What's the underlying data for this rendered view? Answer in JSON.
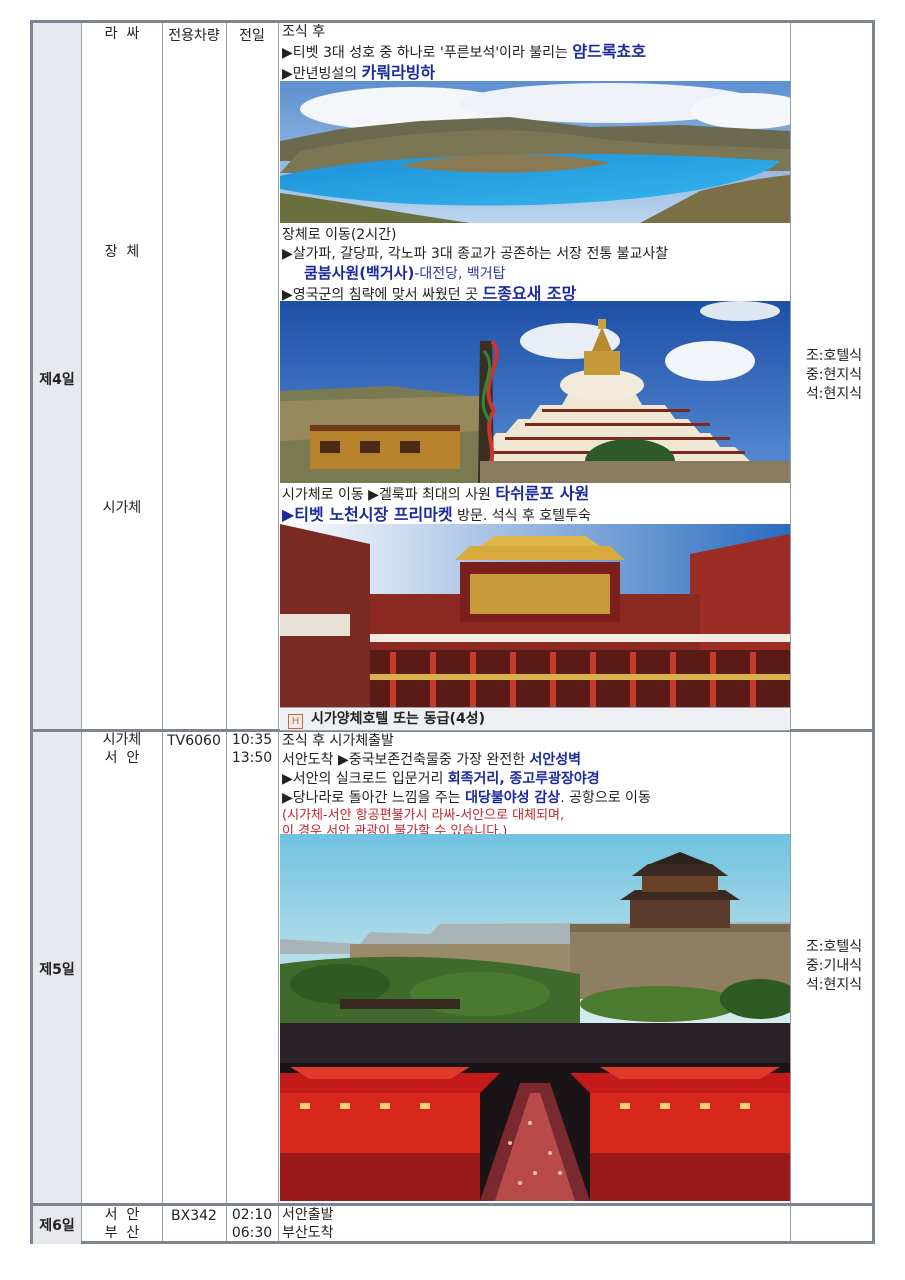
{
  "header": {
    "vehicle": "전용차량",
    "day_trip": "전일"
  },
  "day4": {
    "label": "제4일",
    "places": [
      "라  싸",
      "장  체",
      "시가체"
    ],
    "lines": {
      "breakfast": "조식 후",
      "l1_prefix": "▶티벳 3대 성호 중 하나로 '푸른보석'이라 불리는 ",
      "l1_highlight": "얌드록쵸호",
      "l2_prefix": "▶만년빙설의 ",
      "l2_highlight": "카뤄라빙하",
      "l3": "장체로 이동(2시간)",
      "l4": "▶살가파, 갈당파, 각노파 3대 종교가 공존하는 서장 전통 불교사찰",
      "l5_highlight": "쿰붐사원(백거사)",
      "l5_suffix": "-대전당, 백거탑",
      "l6_prefix": "▶영국군의 침략에 맞서 싸웠던 곳 ",
      "l6_highlight": "드종요새 조망",
      "l7_prefix": "시가체로 이동 ▶겔룩파 최대의 사원 ",
      "l7_highlight": "타쉬룬포 사원",
      "l8_highlight": "▶티벳 노천시장 프리마켓",
      "l8_suffix": " 방문. 석식 후 호텔투숙"
    },
    "hotel_icon": "H",
    "hotel": "시가양체호텔 또는 동급(4성)",
    "meals": [
      "조:호텔식",
      "중:현지식",
      "석:현지식"
    ]
  },
  "day5": {
    "label": "제5일",
    "places": "시가체\n서  안",
    "flight": "TV6060",
    "times": "10:35\n13:50",
    "lines": {
      "l1": "조식 후 시가체출발",
      "l2_prefix": "서안도착 ▶중국보존건축물중 가장 완전한 ",
      "l2_highlight": "서안성벽",
      "l3_prefix": "▶서안의 실크로드 입문거리 ",
      "l3_highlight": "회족거리, 종고루광장야경",
      "l4_prefix": "▶당나라로 돌아간 느낌을 주는 ",
      "l4_highlight": "대당불야성 감상",
      "l4_suffix": ". 공항으로 이동",
      "note1": "(시가체-서안 항공편불가시 라싸-서안으로 대체되며,",
      "note2": " 이 경우 서안 관광이 불가할 수 있습니다.)"
    },
    "meals": [
      "조:호텔식",
      "중:기내식",
      "석:현지식"
    ]
  },
  "day6": {
    "label": "제6일",
    "places": "서  안\n부  산",
    "flight": "BX342",
    "times": "02:10\n06:30",
    "lines": {
      "l1": "서안출발",
      "l2": "부산도착"
    }
  },
  "colors": {
    "highlight_blue": "#1a2a9e",
    "note_red": "#c1272d",
    "day_bg": "#e6e8ee",
    "border": "#7d8390"
  }
}
